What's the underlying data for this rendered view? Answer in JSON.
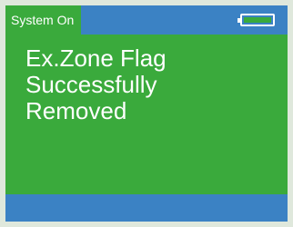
{
  "status": {
    "label": "System On",
    "battery_icon": "battery-icon",
    "battery_level": 1.0
  },
  "message": {
    "lines": [
      "Ex.Zone Flag",
      "Successfully",
      "Removed"
    ]
  },
  "colors": {
    "screen_green": "#3aaa3c",
    "bar_blue": "#3b82c4",
    "text": "#ffffff",
    "bezel": "#dfe8dc"
  }
}
